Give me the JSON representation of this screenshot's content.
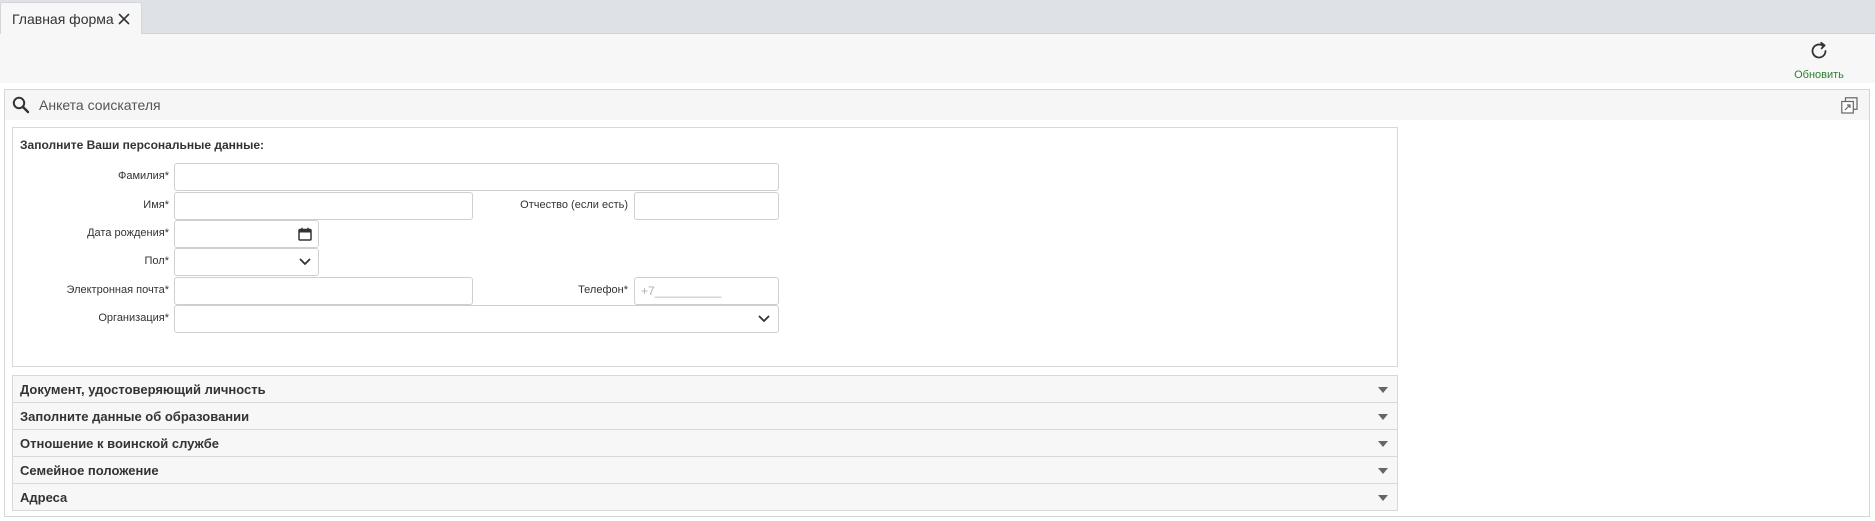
{
  "tabs": [
    {
      "label": "Главная форма",
      "close_icon": "close-icon"
    }
  ],
  "toolbar": {
    "refresh_label": "Обновить",
    "refresh_icon": "refresh-icon",
    "accent_color": "#2e7d32"
  },
  "panel": {
    "title": "Анкета соискателя",
    "search_icon": "search-icon",
    "expand_icon": "expand-icon"
  },
  "personal": {
    "title": "Заполните Ваши персональные данные:",
    "fields": {
      "last_name": {
        "label": "Фамилия*",
        "value": ""
      },
      "first_name": {
        "label": "Имя*",
        "value": ""
      },
      "patronymic": {
        "label": "Отчество (если есть)",
        "value": ""
      },
      "birth_date": {
        "label": "Дата рождения*",
        "value": "",
        "icon": "calendar-icon"
      },
      "gender": {
        "label": "Пол*",
        "value": "",
        "icon": "chevron-down-icon"
      },
      "email": {
        "label": "Электронная почта*",
        "value": ""
      },
      "phone": {
        "label": "Телефон*",
        "value": "",
        "placeholder": "+7__________"
      },
      "organization": {
        "label": "Организация*",
        "value": "",
        "icon": "chevron-down-icon"
      }
    }
  },
  "sections": [
    {
      "label": "Документ, удостоверяющий личность"
    },
    {
      "label": "Заполните данные об образовании"
    },
    {
      "label": "Отношение к воинской службе"
    },
    {
      "label": "Семейное положение"
    },
    {
      "label": "Адреса"
    }
  ]
}
